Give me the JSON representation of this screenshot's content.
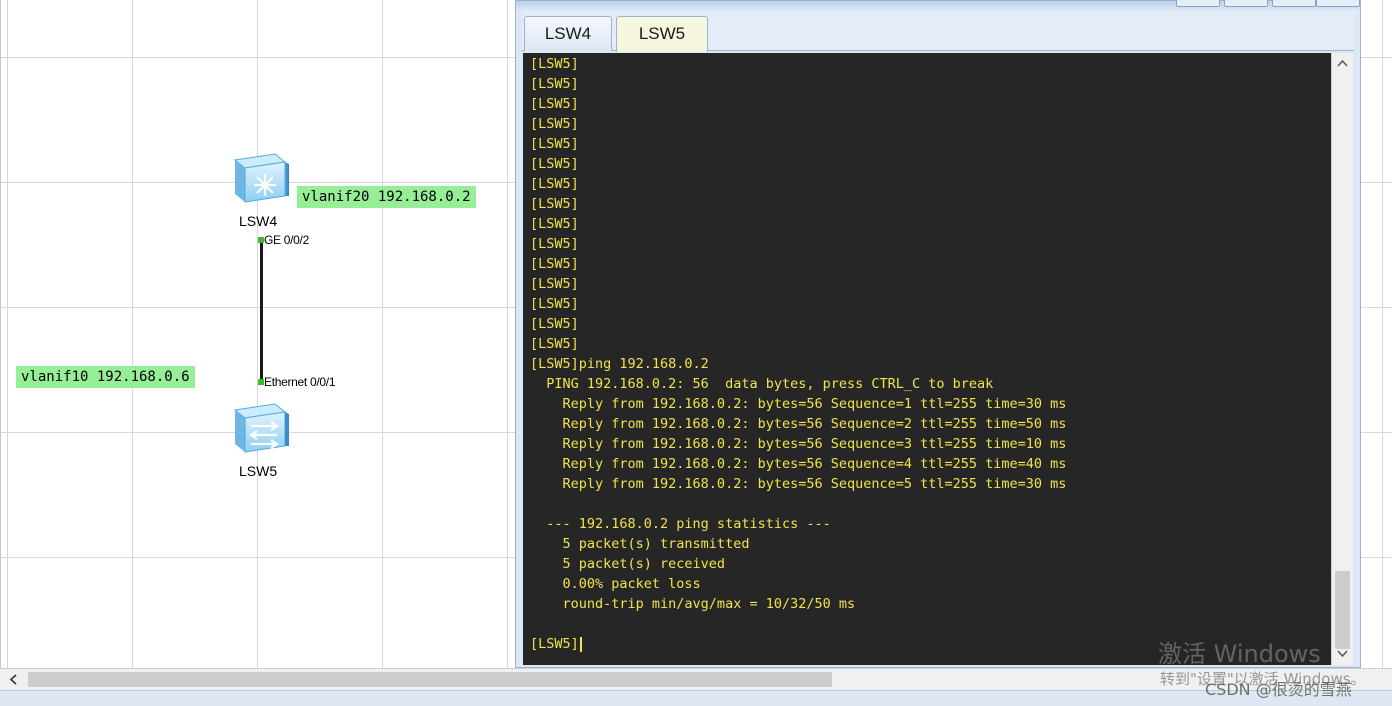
{
  "topology": {
    "devices": [
      {
        "name": "LSW4"
      },
      {
        "name": "LSW5"
      }
    ],
    "ports": {
      "lsw4_port": "GE 0/0/2",
      "lsw5_port": "Ethernet 0/0/1"
    },
    "ip_tags": {
      "lsw4": "vlanif20 192.168.0.2",
      "lsw5": "vlanif10 192.168.0.6"
    }
  },
  "terminal": {
    "tabs": [
      "LSW4",
      "LSW5"
    ],
    "active_tab": "LSW5",
    "lines": [
      "[LSW5]",
      "[LSW5]",
      "[LSW5]",
      "[LSW5]",
      "[LSW5]",
      "[LSW5]",
      "[LSW5]",
      "[LSW5]",
      "[LSW5]",
      "[LSW5]",
      "[LSW5]",
      "[LSW5]",
      "[LSW5]",
      "[LSW5]",
      "[LSW5]",
      "[LSW5]ping 192.168.0.2",
      "  PING 192.168.0.2: 56  data bytes, press CTRL_C to break",
      "    Reply from 192.168.0.2: bytes=56 Sequence=1 ttl=255 time=30 ms",
      "    Reply from 192.168.0.2: bytes=56 Sequence=2 ttl=255 time=50 ms",
      "    Reply from 192.168.0.2: bytes=56 Sequence=3 ttl=255 time=10 ms",
      "    Reply from 192.168.0.2: bytes=56 Sequence=4 ttl=255 time=40 ms",
      "    Reply from 192.168.0.2: bytes=56 Sequence=5 ttl=255 time=30 ms",
      "",
      "  --- 192.168.0.2 ping statistics ---",
      "    5 packet(s) transmitted",
      "    5 packet(s) received",
      "    0.00% packet loss",
      "    round-trip min/avg/max = 10/32/50 ms",
      ""
    ],
    "prompt": "[LSW5]"
  },
  "watermarks": {
    "activate_title": "激活 Windows",
    "activate_sub": "转到\"设置\"以激活 Windows。",
    "csdn": "CSDN @很烫的雪燕"
  },
  "colors": {
    "terminal_bg": "#262626",
    "terminal_text": "#f2e44c",
    "ip_tag_bg": "#96ee96",
    "port_dot": "#3dbb2c",
    "active_tab_bg": "#f6f6de"
  },
  "icons": {
    "switch": "switch-icon",
    "scroll_up": "chevron-up-icon",
    "scroll_down": "chevron-down-icon",
    "scroll_left": "chevron-left-icon"
  }
}
